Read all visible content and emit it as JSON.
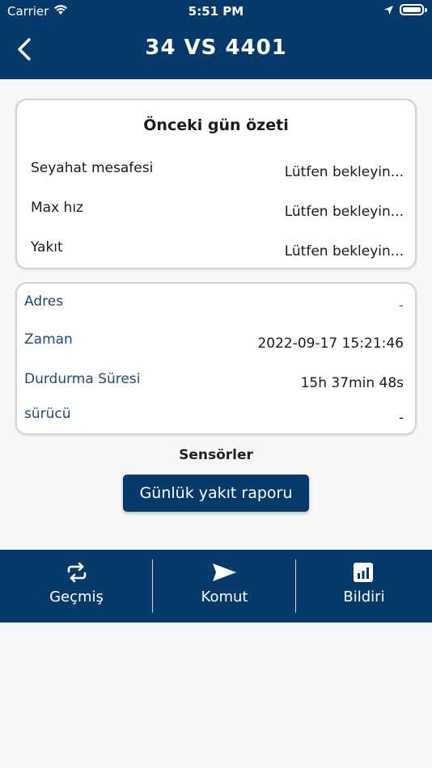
{
  "status_bar": {
    "carrier": "Carrier",
    "time": "5:51 PM"
  },
  "header": {
    "title": "34 VS 4401"
  },
  "summary": {
    "title": "Önceki gün özeti",
    "rows": [
      {
        "label": "Seyahat mesafesi",
        "value": "Lütfen bekleyin..."
      },
      {
        "label": "Max hız",
        "value": "Lütfen bekleyin..."
      },
      {
        "label": "Yakıt",
        "value": "Lütfen bekleyin..."
      }
    ]
  },
  "details": {
    "rows": [
      {
        "label": "Adres",
        "value": "-"
      },
      {
        "label": "Zaman",
        "value": "2022-09-17 15:21:46"
      },
      {
        "label": "Durdurma Süresi",
        "value": "15h 37min 48s"
      },
      {
        "label": "sürücü",
        "value": "-"
      }
    ]
  },
  "sensors": {
    "title": "Sensörler",
    "button_label": "Günlük yakıt raporu"
  },
  "tabs": [
    {
      "label": "Geçmiş",
      "icon": "repeat-icon"
    },
    {
      "label": "Komut",
      "icon": "send-icon"
    },
    {
      "label": "Bildiri",
      "icon": "report-chart-icon"
    }
  ],
  "colors": {
    "primary": "#063a6b",
    "label_blue": "#1b4a78",
    "accent": "#3a79c9"
  }
}
